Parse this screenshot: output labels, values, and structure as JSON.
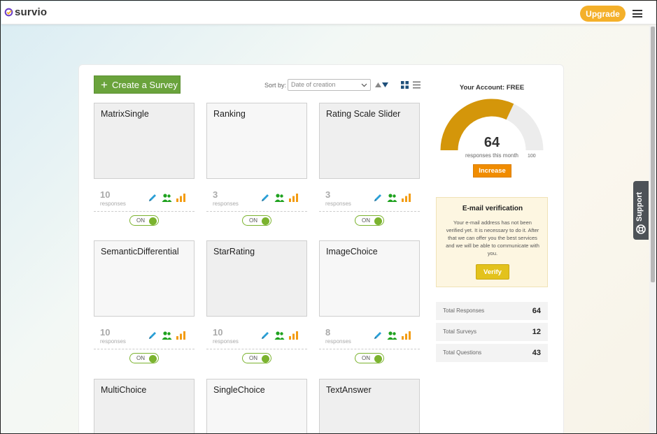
{
  "header": {
    "logo_text": "survio",
    "upgrade_label": "Upgrade"
  },
  "support_label": "Support",
  "toolbar": {
    "create_label": "Create a Survey",
    "sort_label": "Sort by:",
    "sort_value": "Date of creation"
  },
  "cards": [
    {
      "title": "MatrixSingle",
      "responses": "10",
      "responses_label": "responses",
      "toggle": "ON"
    },
    {
      "title": "Ranking",
      "responses": "3",
      "responses_label": "responses",
      "toggle": "ON"
    },
    {
      "title": "Rating Scale Slider",
      "responses": "3",
      "responses_label": "responses",
      "toggle": "ON"
    },
    {
      "title": "SemanticDifferential",
      "responses": "10",
      "responses_label": "responses",
      "toggle": "ON"
    },
    {
      "title": "StarRating",
      "responses": "10",
      "responses_label": "responses",
      "toggle": "ON"
    },
    {
      "title": "ImageChoice",
      "responses": "8",
      "responses_label": "responses",
      "toggle": "ON"
    },
    {
      "title": "MultiChoice"
    },
    {
      "title": "SingleChoice"
    },
    {
      "title": "TextAnswer"
    }
  ],
  "account": {
    "label": "Your Account:",
    "plan": "FREE",
    "responses_value": "64",
    "responses_max": "100",
    "gauge_fraction": 0.64,
    "responses_sub": "responses this month",
    "increase_label": "Increase"
  },
  "verification": {
    "title": "E-mail verification",
    "text": "Your e-mail address has not been verified yet. It is necessary to do it. After that we can offer you the best services and we will be able to communicate with you.",
    "verify_label": "Verify"
  },
  "totals": [
    {
      "label": "Total Responses",
      "value": "64"
    },
    {
      "label": "Total Surveys",
      "value": "12"
    },
    {
      "label": "Total Questions",
      "value": "43"
    }
  ],
  "colors": {
    "brand_purple": "#6a3fc7",
    "upgrade": "#f4b02a",
    "create": "#6aa33c",
    "gauge": "#d4960a",
    "increase": "#f08c00",
    "verify": "#e3c21c",
    "toggle": "#7bb32e"
  }
}
